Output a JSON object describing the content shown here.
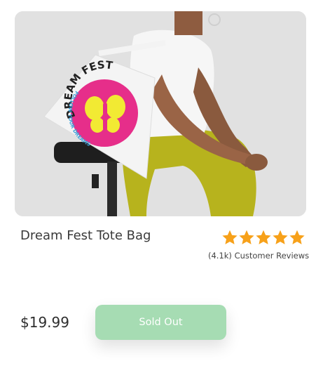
{
  "product": {
    "name": "Dream Fest Tote Bag",
    "price": "$19.99",
    "rating": 5,
    "rating_max": 5,
    "reviews_label": "(4.1k) Customer Reviews",
    "button_label": "Sold Out",
    "bag_print": {
      "top_text": "DREAM FEST",
      "bottom_text": "FOLLOW YOUR DREAMS",
      "icon": "butterfly-icon"
    }
  },
  "colors": {
    "button": "#a6dcb3",
    "star": "#f7a11a",
    "pants": "#b7b31d",
    "bag_badge": "#e62e8a"
  }
}
